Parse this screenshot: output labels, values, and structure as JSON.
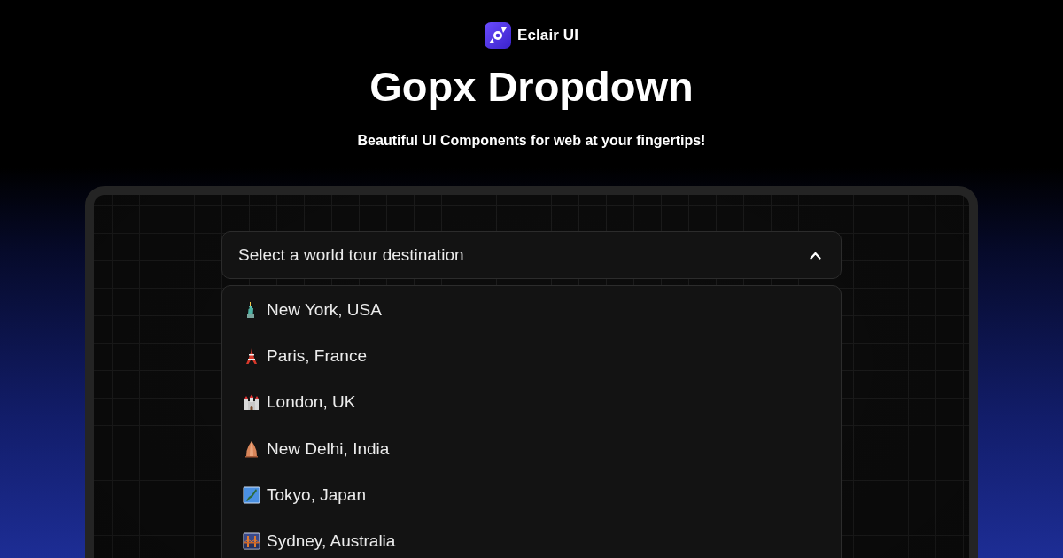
{
  "brand": {
    "name": "Eclair UI"
  },
  "title": "Gopx Dropdown",
  "subtitle": "Beautiful UI Components for web at your fingertips!",
  "dropdown": {
    "placeholder": "Select a world tour destination",
    "expanded": true,
    "options": [
      {
        "label": "New York, USA",
        "selected": false
      },
      {
        "label": "Paris, France",
        "selected": false
      },
      {
        "label": "London, UK",
        "selected": false
      },
      {
        "label": "New Delhi, India",
        "selected": false
      },
      {
        "label": "Tokyo, Japan",
        "selected": false
      },
      {
        "label": "Sydney, Australia",
        "selected": false
      }
    ]
  }
}
